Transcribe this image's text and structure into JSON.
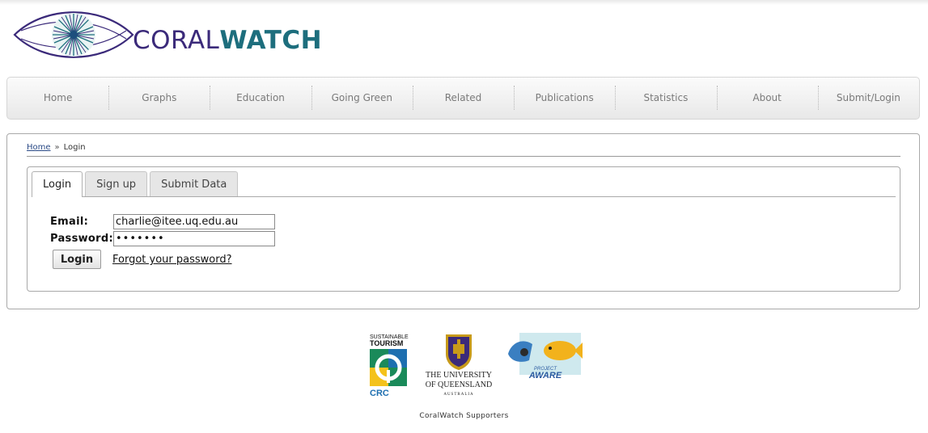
{
  "header": {
    "logo_text_part1": "CORAL",
    "logo_text_part2": "WATCH",
    "logo_icon": "eye-icon"
  },
  "nav": {
    "items": [
      "Home",
      "Graphs",
      "Education",
      "Going Green",
      "Related",
      "Publications",
      "Statistics",
      "About",
      "Submit/Login"
    ]
  },
  "breadcrumb": {
    "home": "Home",
    "separator": "»",
    "current": "Login"
  },
  "tabs": [
    {
      "label": "Login",
      "active": true
    },
    {
      "label": "Sign up",
      "active": false
    },
    {
      "label": "Submit Data",
      "active": false
    }
  ],
  "login_form": {
    "email_label": "Email:",
    "email_value": "charlie@itee.uq.edu.au",
    "password_label": "Password:",
    "password_value": "•••••••",
    "login_button": "Login",
    "forgot_link": "Forgot your password?"
  },
  "sponsors": {
    "tourism_line1": "SUSTAINABLE",
    "tourism_line2": "TOURISM",
    "tourism_line3": "CRC",
    "uq_line1": "THE UNIVERSITY",
    "uq_line2": "OF QUEENSLAND",
    "uq_line3": "AUSTRALIA",
    "aware_line1": "PROJECT",
    "aware_line2": "AWARE",
    "caption": "CoralWatch Supporters"
  },
  "colors": {
    "brand_purple": "#3b2a7a",
    "brand_teal": "#1d6e7d",
    "link": "#2a4a86"
  }
}
